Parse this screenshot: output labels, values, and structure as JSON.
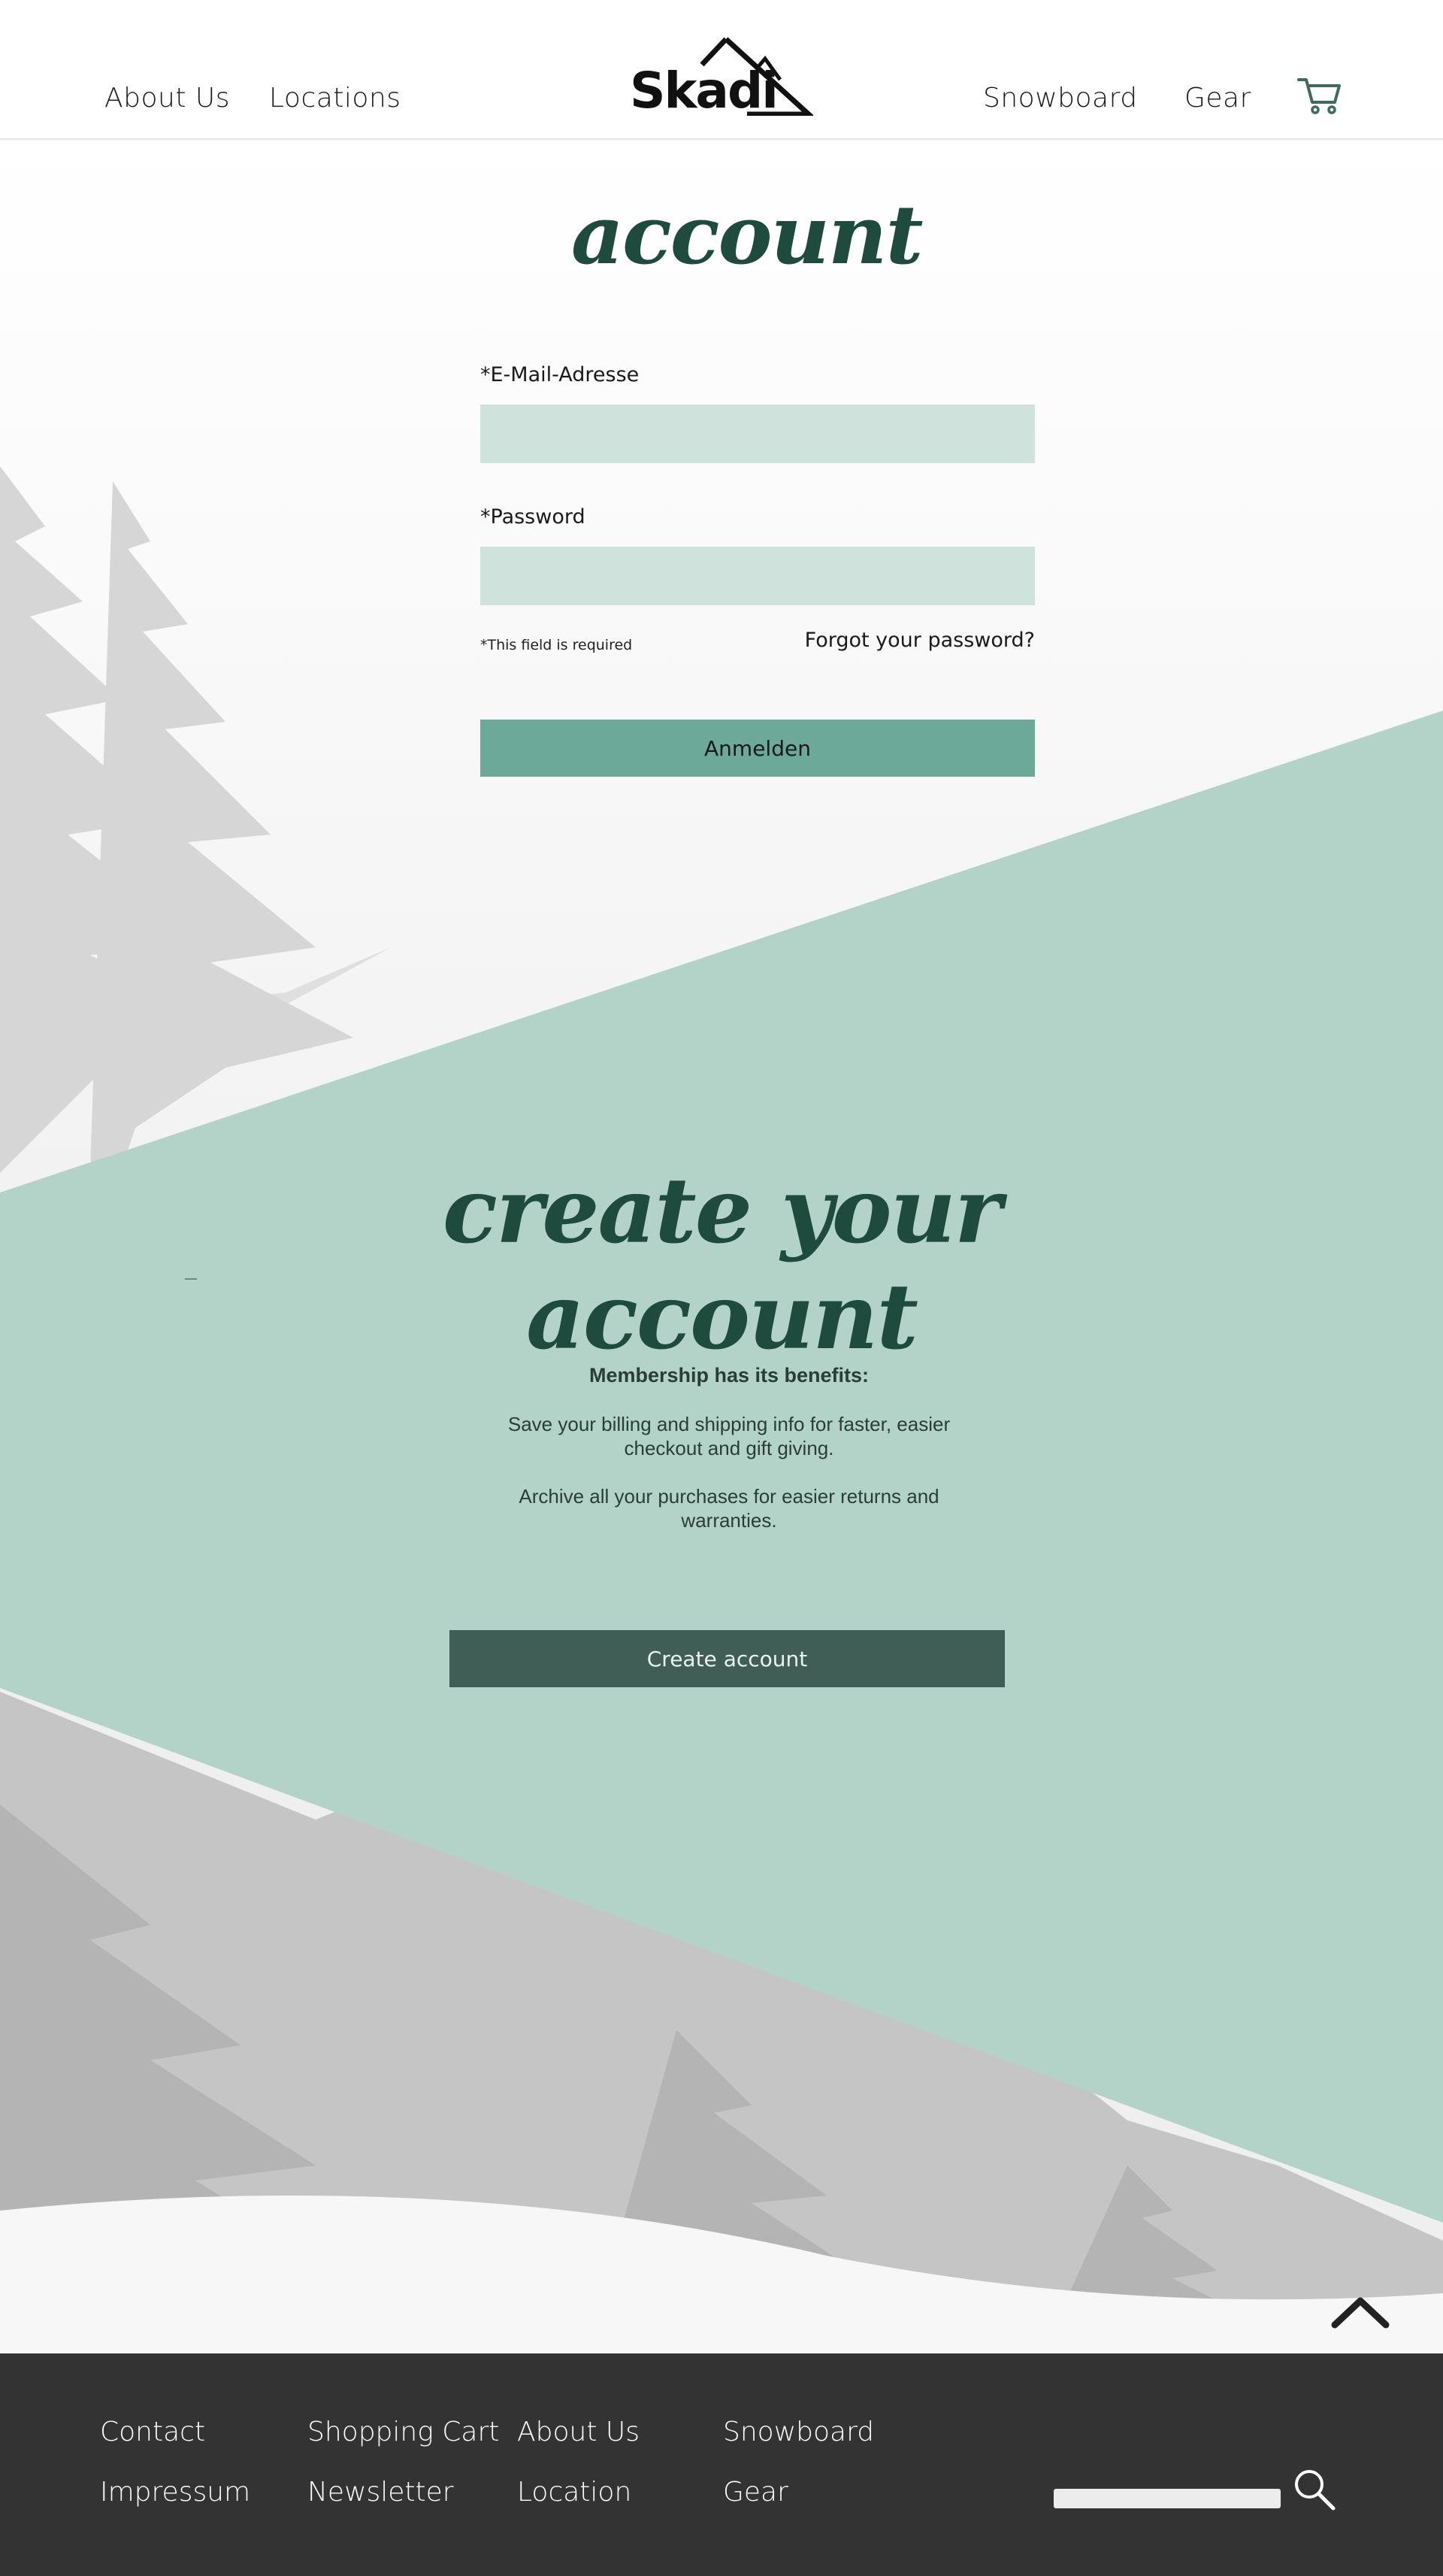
{
  "header": {
    "nav_left": [
      "About Us",
      "Locations"
    ],
    "brand": "Skadi",
    "nav_right": [
      "Snowboard",
      "Gear"
    ],
    "cart_icon": "shopping-cart-icon"
  },
  "login": {
    "title": "account",
    "email_label": "*E-Mail-Adresse",
    "email_value": "",
    "password_label": "*Password",
    "password_value": "",
    "required_note": "*This field is required",
    "forgot_link": "Forgot your password?",
    "submit_label": "Anmelden"
  },
  "register": {
    "title": "create your account",
    "benefits_title": "Membership has its benefits:",
    "benefit_1": "Save your billing and shipping info for faster, easier checkout and gift giving.",
    "benefit_2": "Archive all your purchases for easier returns and warranties.",
    "button_label": "Create account",
    "back_to_top_icon": "chevron-up-icon"
  },
  "footer": {
    "col1": [
      "Contact",
      "Impressum"
    ],
    "col2": [
      "Shopping Cart",
      "Newsletter"
    ],
    "col3": [
      "About Us",
      "Location"
    ],
    "col4": [
      "Snowboard",
      "Gear"
    ],
    "search_value": "",
    "search_icon": "search-icon"
  },
  "colors": {
    "mint": "#b3d3c9",
    "field": "#cfe2dc",
    "accent": "#6ca998",
    "dark_green": "#405e55",
    "title_green": "#1f4a3e",
    "footer": "#333333"
  }
}
